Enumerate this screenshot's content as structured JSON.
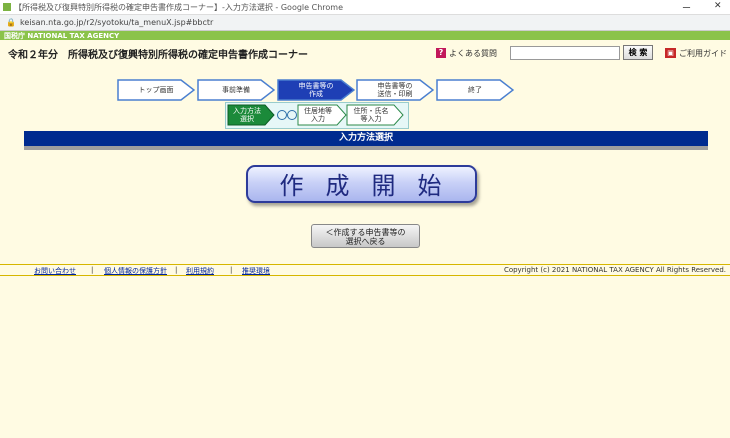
{
  "browser": {
    "window_title": "【所得税及び復興特別所得税の確定申告書作成コーナー】-入力方法選択 - Google Chrome",
    "url": "keisan.nta.go.jp/r2/syotoku/ta_menuX.jsp#bbctr",
    "minimize_glyph": "ー",
    "restore_glyph": "❐",
    "close_glyph": "✕"
  },
  "agency": {
    "label": "国税庁  NATIONAL TAX AGENCY"
  },
  "header": {
    "title": "令和２年分　所得税及び復興特別所得税の確定申告書作成コーナー",
    "faq_label": "よくある質問",
    "faq_icon": "?",
    "search_placeholder": "",
    "search_button": "検 索",
    "guide_label": "ご利用ガイド",
    "guide_icon": "▣"
  },
  "steps": [
    {
      "label": "トップ画面",
      "active": false
    },
    {
      "label": "事前準備",
      "active": false
    },
    {
      "label": "申告書等の\n作成",
      "active": true
    },
    {
      "label": "申告書等の\n送信・印刷",
      "active": false
    },
    {
      "label": "終了",
      "active": false
    }
  ],
  "substeps": [
    {
      "label": "入力方法\n選択",
      "active": true
    },
    {
      "label": "住居地等\n入力",
      "active": false
    },
    {
      "label": "住所・氏名\n等入力",
      "active": false
    }
  ],
  "section": {
    "title": "入力方法選択"
  },
  "main": {
    "start_label": "作成開始",
    "back_label": "＜作成する申告書等の\n選択へ戻る"
  },
  "footer": {
    "links": [
      "お問い合わせ",
      "個人情報の保護方針",
      "利用規約",
      "推奨環境"
    ],
    "copyright": "Copyright (c) 2021 NATIONAL TAX AGENCY All Rights Reserved."
  },
  "colors": {
    "active_step": "#1e3fb5",
    "active_substep": "#1b8a3a",
    "section_bar": "#002b8f",
    "agency_bar": "#8bc34a"
  }
}
